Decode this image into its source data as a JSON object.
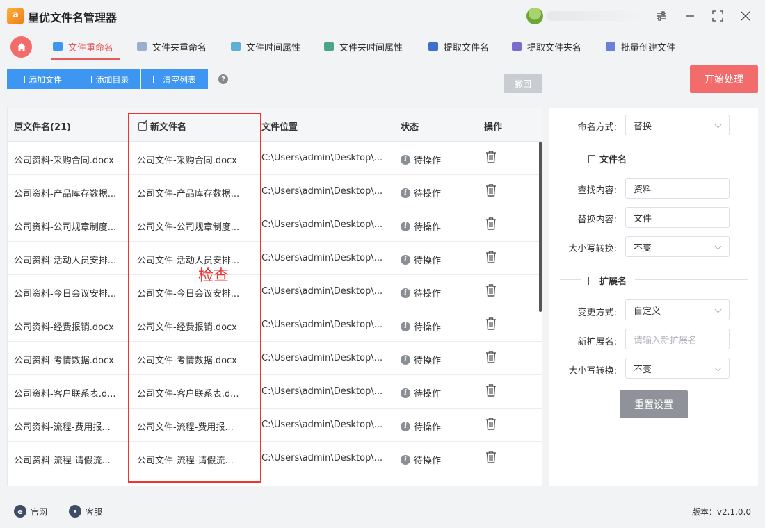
{
  "app": {
    "title": "星优文件名管理器"
  },
  "nav": {
    "tabs": [
      {
        "label": "文件重命名",
        "active": true,
        "icon": "rename-file-icon",
        "color": "#3e96f3"
      },
      {
        "label": "文件夹重命名",
        "icon": "rename-folder-icon",
        "color": "#9aaecf"
      },
      {
        "label": "文件时间属性",
        "icon": "file-time-icon",
        "color": "#5fb0d6"
      },
      {
        "label": "文件夹时间属性",
        "icon": "folder-time-icon",
        "color": "#4aa58a"
      },
      {
        "label": "提取文件名",
        "icon": "extract-filename-icon",
        "color": "#3e6fc9"
      },
      {
        "label": "提取文件夹名",
        "icon": "extract-foldername-icon",
        "color": "#7a6ccf"
      },
      {
        "label": "批量创建文件",
        "icon": "batch-create-icon",
        "color": "#6a7fd8"
      }
    ]
  },
  "toolbar": {
    "add_file": "添加文件",
    "add_dir": "添加目录",
    "clear_list": "清空列表",
    "help": "?",
    "undo": "撤回",
    "start": "开始处理"
  },
  "table": {
    "headers": {
      "orig": "原文件名(21)",
      "new": "新文件名",
      "location": "文件位置",
      "status": "状态",
      "op": "操作"
    },
    "rows": [
      {
        "orig": "公司资料-采购合同.docx",
        "new": "公司文件-采购合同.docx",
        "location": "C:\\Users\\admin\\Desktop\\...",
        "status": "待操作"
      },
      {
        "orig": "公司资料-产品库存数据...",
        "new": "公司文件-产品库存数据...",
        "location": "C:\\Users\\admin\\Desktop\\...",
        "status": "待操作"
      },
      {
        "orig": "公司资料-公司规章制度...",
        "new": "公司文件-公司规章制度...",
        "location": "C:\\Users\\admin\\Desktop\\...",
        "status": "待操作"
      },
      {
        "orig": "公司资料-活动人员安排...",
        "new": "公司文件-活动人员安排...",
        "location": "C:\\Users\\admin\\Desktop\\...",
        "status": "待操作"
      },
      {
        "orig": "公司资料-今日会议安排...",
        "new": "公司文件-今日会议安排...",
        "location": "C:\\Users\\admin\\Desktop\\...",
        "status": "待操作"
      },
      {
        "orig": "公司资料-经费报销.docx",
        "new": "公司文件-经费报销.docx",
        "location": "C:\\Users\\admin\\Desktop\\...",
        "status": "待操作"
      },
      {
        "orig": "公司资料-考情数据.docx",
        "new": "公司文件-考情数据.docx",
        "location": "C:\\Users\\admin\\Desktop\\...",
        "status": "待操作"
      },
      {
        "orig": "公司资料-客户联系表.d...",
        "new": "公司文件-客户联系表.d...",
        "location": "C:\\Users\\admin\\Desktop\\...",
        "status": "待操作"
      },
      {
        "orig": "公司资料-流程-费用报...",
        "new": "公司文件-流程-费用报...",
        "location": "C:\\Users\\admin\\Desktop\\...",
        "status": "待操作"
      },
      {
        "orig": "公司资料-流程-请假流...",
        "new": "公司文件-流程-请假流...",
        "location": "C:\\Users\\admin\\Desktop\\...",
        "status": "待操作"
      }
    ]
  },
  "annotation": {
    "text": "检查",
    "color": "#e33333"
  },
  "panel": {
    "naming_mode_label": "命名方式:",
    "naming_mode_value": "替换",
    "filename_section": "文件名",
    "find_label": "查找内容:",
    "find_value": "资料",
    "replace_label": "替换内容:",
    "replace_value": "文件",
    "case_label": "大小写转换:",
    "case_value": "不变",
    "ext_section": "扩展名",
    "change_mode_label": "变更方式:",
    "change_mode_value": "自定义",
    "new_ext_label": "新扩展名:",
    "new_ext_placeholder": "请输入新扩展名",
    "ext_case_label": "大小写转换:",
    "ext_case_value": "不变",
    "reset": "重置设置"
  },
  "footer": {
    "website": "官网",
    "support": "客服",
    "version": "版本：v2.1.0.0"
  }
}
